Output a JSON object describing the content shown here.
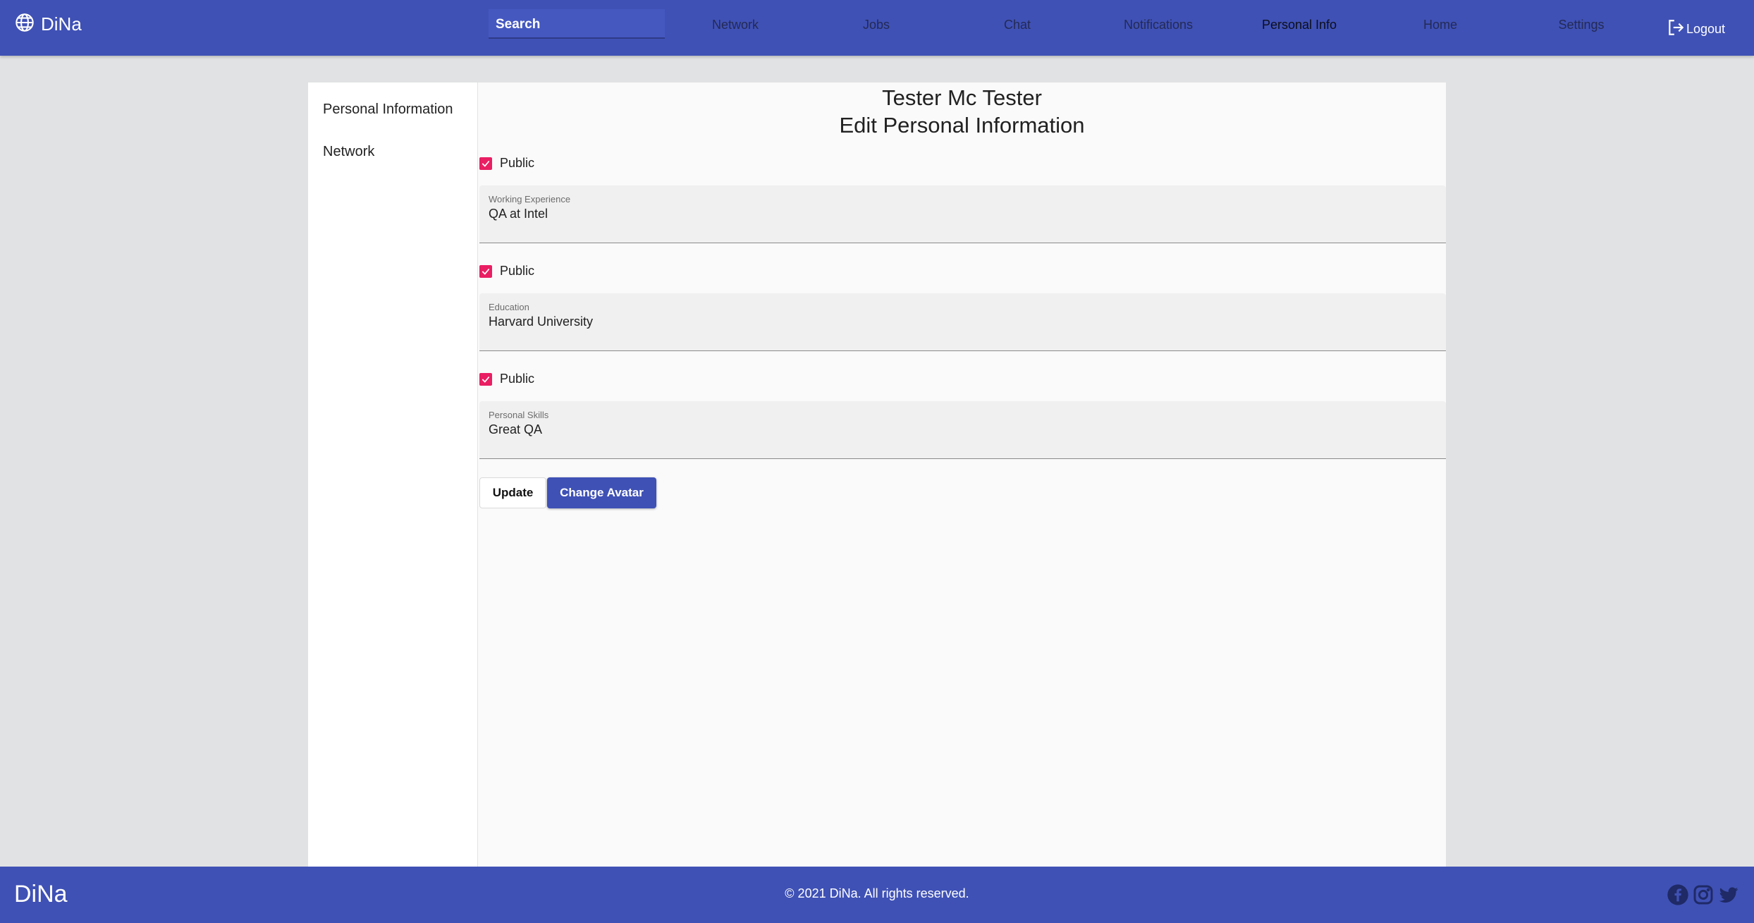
{
  "header": {
    "brand": "DiNa",
    "search_label": "Search",
    "nav": [
      "Network",
      "Jobs",
      "Chat",
      "Notifications",
      "Personal Info",
      "Home",
      "Settings"
    ],
    "active_nav": "Personal Info",
    "logout_label": "Logout",
    "brand_color": "#3f51b5"
  },
  "sidebar": {
    "items": [
      {
        "label": "Personal Information"
      },
      {
        "label": "Network"
      }
    ]
  },
  "main": {
    "name": "Tester Mc Tester",
    "heading": "Edit Personal Information",
    "fields": [
      {
        "public_label": "Public",
        "public_checked": true,
        "label": "Working Experience",
        "value": "QA at Intel"
      },
      {
        "public_label": "Public",
        "public_checked": true,
        "label": "Education",
        "value": "Harvard University"
      },
      {
        "public_label": "Public",
        "public_checked": true,
        "label": "Personal Skills",
        "value": "Great QA"
      }
    ],
    "update_label": "Update",
    "change_avatar_label": "Change Avatar",
    "checkbox_color": "#e91e63"
  },
  "footer": {
    "brand": "DiNa",
    "copyright": "© 2021 DiNa. All rights reserved.",
    "social_icons": [
      "facebook-icon",
      "instagram-icon",
      "twitter-icon"
    ]
  }
}
